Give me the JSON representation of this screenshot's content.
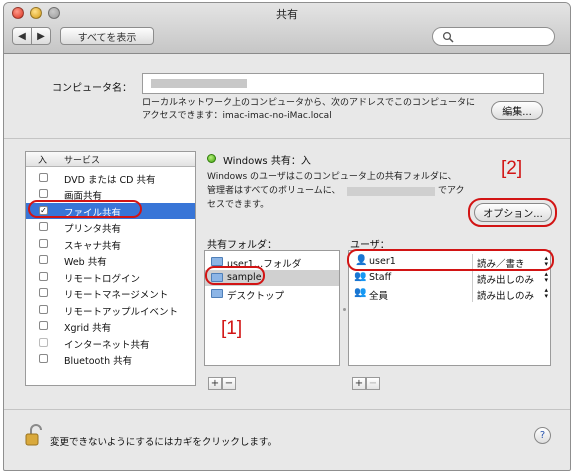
{
  "window": {
    "title": "共有"
  },
  "toolbar": {
    "show_all": "すべてを表示"
  },
  "computer": {
    "label": "コンピュータ名：",
    "local_info_line1": "ローカルネットワーク上のコンピュータから、次のアドレスでこのコンピュータに",
    "local_info_line2": "アクセスできます：imac-imac-no-iMac.local",
    "edit_button": "編集..."
  },
  "services": {
    "header_on": "入",
    "header_service": "サービス",
    "items": [
      {
        "label": "DVD または CD 共有",
        "checked": false
      },
      {
        "label": "画面共有",
        "checked": false
      },
      {
        "label": "ファイル共有",
        "checked": true
      },
      {
        "label": "プリンタ共有",
        "checked": false
      },
      {
        "label": "スキャナ共有",
        "checked": false
      },
      {
        "label": "Web 共有",
        "checked": false
      },
      {
        "label": "リモートログイン",
        "checked": false
      },
      {
        "label": "リモートマネージメント",
        "checked": false
      },
      {
        "label": "リモートアップルイベント",
        "checked": false
      },
      {
        "label": "Xgrid 共有",
        "checked": false
      },
      {
        "label": "インターネット共有",
        "checked": false
      },
      {
        "label": "Bluetooth 共有",
        "checked": false
      }
    ]
  },
  "status": {
    "title": "Windows 共有：入",
    "desc_line1": "Windows のユーザはこのコンピュータ上の共有フォルダに、",
    "desc_line2a": "管理者はすべてのボリュームに、",
    "desc_line2b": "でアク",
    "desc_line3": "セスできます。",
    "options_button": "オプション..."
  },
  "folders": {
    "header": "共有フォルダ：",
    "items": [
      "user1…フォルダ",
      "sample",
      "デスクトップ"
    ]
  },
  "users": {
    "header": "ユーザ：",
    "items": [
      {
        "name": "user1",
        "perm": "読み／書き"
      },
      {
        "name": "Staff",
        "perm": "読み出しのみ"
      },
      {
        "name": "全員",
        "perm": "読み出しのみ"
      }
    ]
  },
  "buttons": {
    "add": "+",
    "remove": "−"
  },
  "annotations": {
    "one": "[1]",
    "two": "[2]"
  },
  "lock": {
    "text": "変更できないようにするにはカギをクリックします。"
  },
  "help": {
    "label": "?"
  },
  "colors": {
    "selection": "#3875d7",
    "annotation": "#d21414"
  }
}
